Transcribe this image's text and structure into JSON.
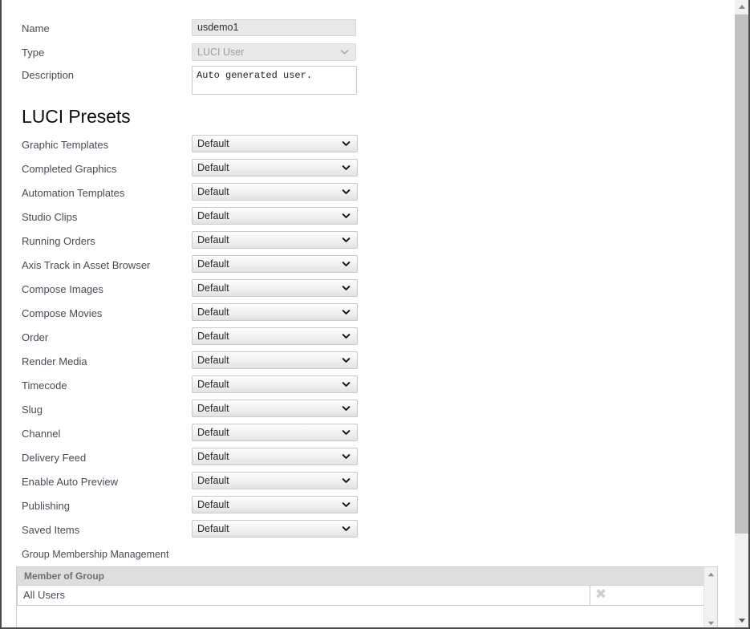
{
  "form": {
    "name": {
      "label": "Name",
      "value": "usdemo1"
    },
    "type": {
      "label": "Type",
      "value": "LUCI User"
    },
    "description": {
      "label": "Description",
      "value": "Auto generated user."
    }
  },
  "presets": {
    "heading": "LUCI Presets",
    "default_value": "Default",
    "rows": [
      {
        "label": "Graphic Templates",
        "value": "Default"
      },
      {
        "label": "Completed Graphics",
        "value": "Default"
      },
      {
        "label": "Automation Templates",
        "value": "Default"
      },
      {
        "label": "Studio Clips",
        "value": "Default"
      },
      {
        "label": "Running Orders",
        "value": "Default"
      },
      {
        "label": "Axis Track in Asset Browser",
        "value": "Default"
      },
      {
        "label": "Compose Images",
        "value": "Default"
      },
      {
        "label": "Compose Movies",
        "value": "Default"
      },
      {
        "label": "Order",
        "value": "Default"
      },
      {
        "label": "Render Media",
        "value": "Default"
      },
      {
        "label": "Timecode",
        "value": "Default"
      },
      {
        "label": "Slug",
        "value": "Default"
      },
      {
        "label": "Channel",
        "value": "Default"
      },
      {
        "label": "Delivery Feed",
        "value": "Default"
      },
      {
        "label": "Enable Auto Preview",
        "value": "Default"
      },
      {
        "label": "Publishing",
        "value": "Default"
      },
      {
        "label": "Saved Items",
        "value": "Default"
      }
    ]
  },
  "group_membership": {
    "label": "Group Membership Management",
    "columns": [
      "Member of Group",
      ""
    ],
    "rows": [
      {
        "group": "All Users",
        "action_icon": "delete-x-icon"
      }
    ]
  },
  "icons": {
    "chevron_down": "chevron-down-icon",
    "scroll_up": "scroll-up-arrow-icon",
    "scroll_down": "scroll-down-arrow-icon",
    "delete": "delete-x-icon"
  },
  "colors": {
    "label_text": "#4a4a55",
    "header_bg": "#dedede",
    "scrollbar_thumb": "#c0c0c0",
    "delete_icon": "#cfcfcf",
    "disabled_text": "#9d9d9d"
  }
}
